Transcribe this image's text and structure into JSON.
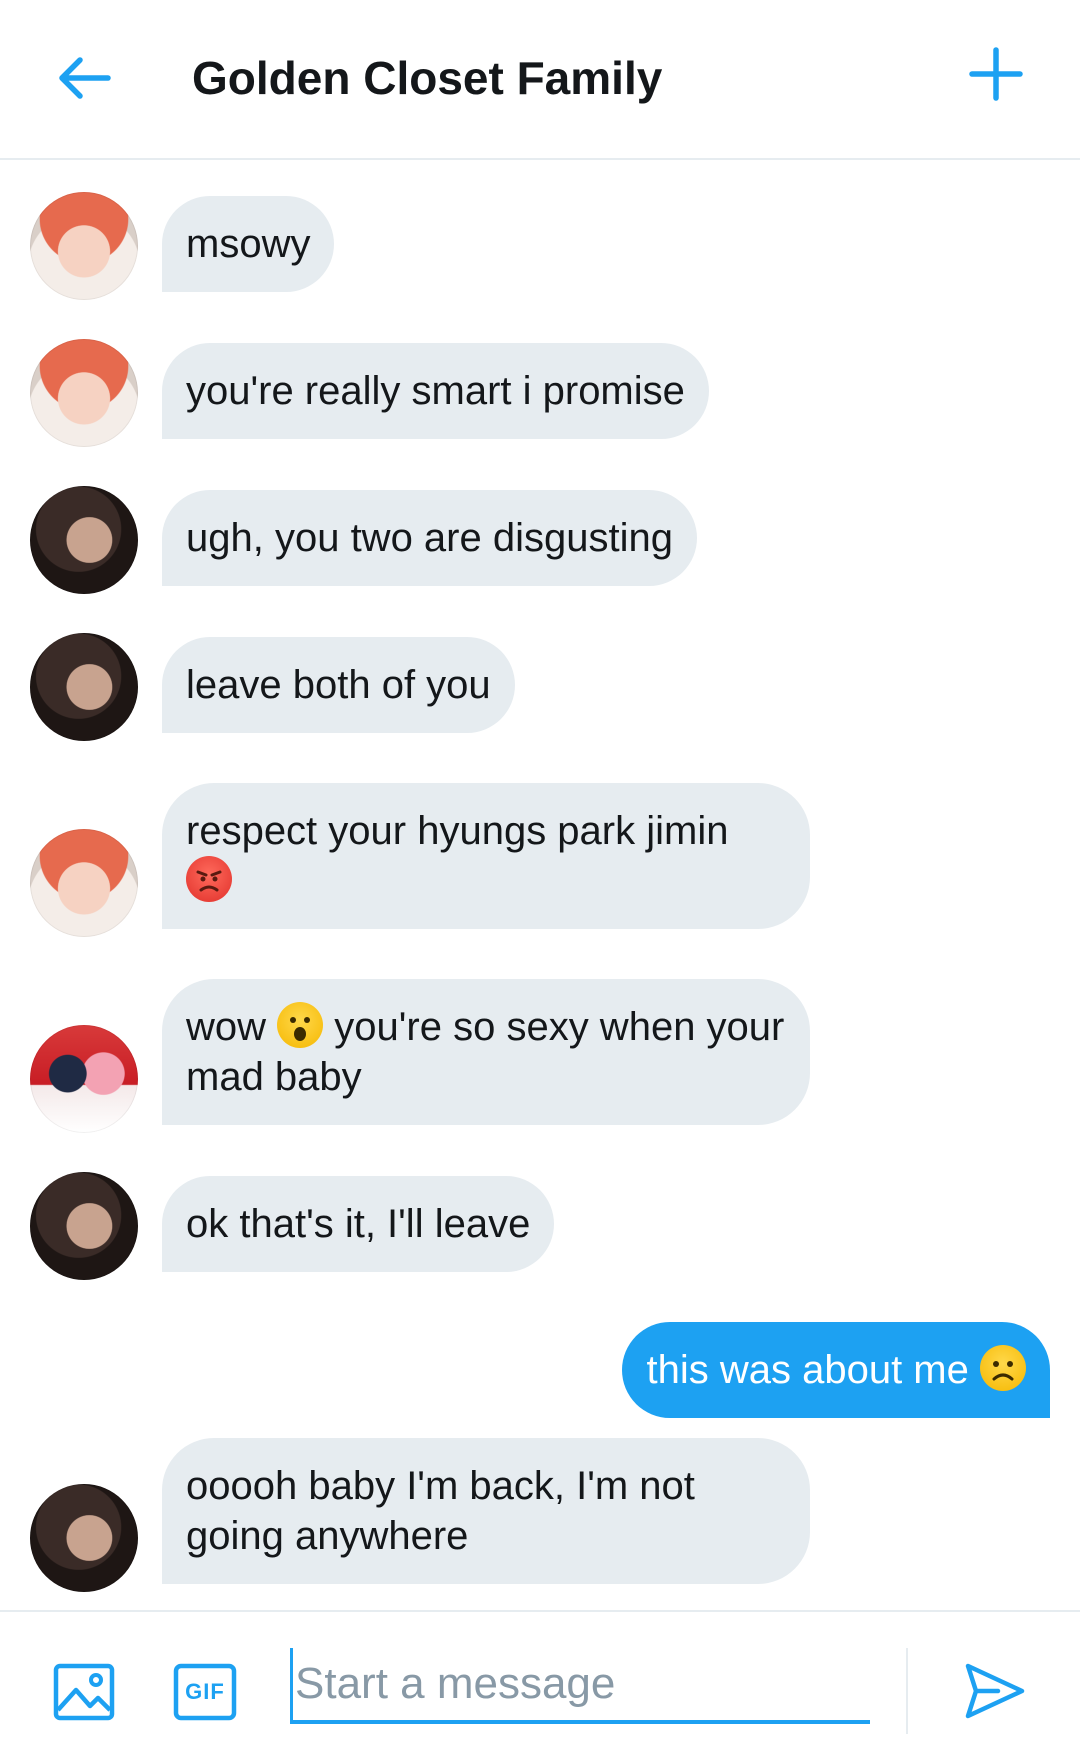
{
  "header": {
    "title": "Golden Closet Family",
    "back_icon": "arrow-left-icon",
    "add_icon": "plus-icon",
    "accent_color": "#1da1f2"
  },
  "messages": [
    {
      "sender": "suga",
      "direction": "received",
      "text": "msowy"
    },
    {
      "sender": "suga",
      "direction": "received",
      "text": "you're really smart i promise"
    },
    {
      "sender": "jimin",
      "direction": "received",
      "text": "ugh, you two are disgusting"
    },
    {
      "sender": "jimin",
      "direction": "received",
      "text": "leave both of you"
    },
    {
      "sender": "suga",
      "direction": "received",
      "text": "respect your hyungs park jimin",
      "emoji": "😡"
    },
    {
      "sender": "couple",
      "direction": "received",
      "text_before": "wow",
      "emoji": "😮",
      "text_after": "you're so sexy when your mad baby"
    },
    {
      "sender": "jimin",
      "direction": "received",
      "text": "ok that's it, I'll leave"
    },
    {
      "sender": "me",
      "direction": "sent",
      "text": "this was about me",
      "emoji": "☹️"
    },
    {
      "sender": "jimin",
      "direction": "received",
      "text": "ooooh baby I'm back, I'm not going anywhere"
    }
  ],
  "composer": {
    "placeholder": "Start a message",
    "media_icon": "image-icon",
    "gif_label": "GIF",
    "send_icon": "send-icon"
  },
  "colors": {
    "received_bubble": "#e6ecf0",
    "sent_bubble": "#1da1f2",
    "text": "#14171a",
    "placeholder": "#8899a6"
  }
}
